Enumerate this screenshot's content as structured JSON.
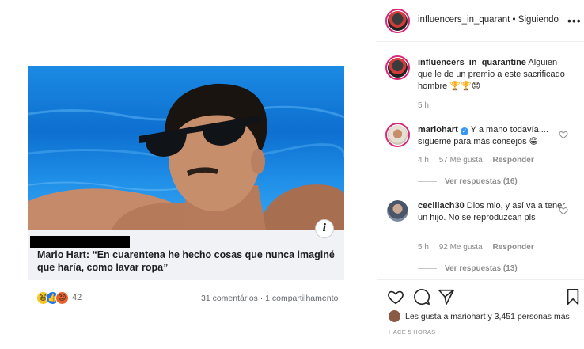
{
  "post": {
    "headline": "Mario Hart: “En cuarentena he hecho cosas que nunca imaginé que haría, como lavar ropa”",
    "reaction_count": "42",
    "stats": "31 comentários · 1 compartilhamento",
    "info_icon": "i"
  },
  "header": {
    "username": "influencers_in_quarant",
    "separator": " • ",
    "follow_status": "Siguiendo",
    "more": "•••"
  },
  "caption": {
    "username": "influencers_in_quarantine",
    "text": " Alguien que le de un premio a este sacrificado hombre 🏆🏆😟",
    "time": "5 h"
  },
  "comments": [
    {
      "username": "mariohart",
      "verified": true,
      "text": " Y a mano todavía.... sígueme para más consejos 😁",
      "time": "4 h",
      "likes": "57 Me gusta",
      "reply": "Responder",
      "view_replies": "Ver respuestas (16)"
    },
    {
      "username": "ceciliach30",
      "verified": false,
      "text": " Dios mio, y así va a tener un hijo. No se reproduzcan pls",
      "time": "5 h",
      "likes": "92 Me gusta",
      "reply": "Responder",
      "view_replies": "Ver respuestas (13)"
    }
  ],
  "likes": {
    "text": "Les gusta a mariohart y 3,451 personas más"
  },
  "time_ago": "HACE 5 HORAS",
  "icons": [
    "heart-icon",
    "comment-icon",
    "share-icon",
    "bookmark-icon",
    "more-icon",
    "verified-icon",
    "info-icon"
  ],
  "colors": {
    "accent_ring": "#d62976",
    "verified": "#3897f0",
    "meta_gray": "#8e8e8e",
    "pool_blue": "#1b8ae3"
  }
}
